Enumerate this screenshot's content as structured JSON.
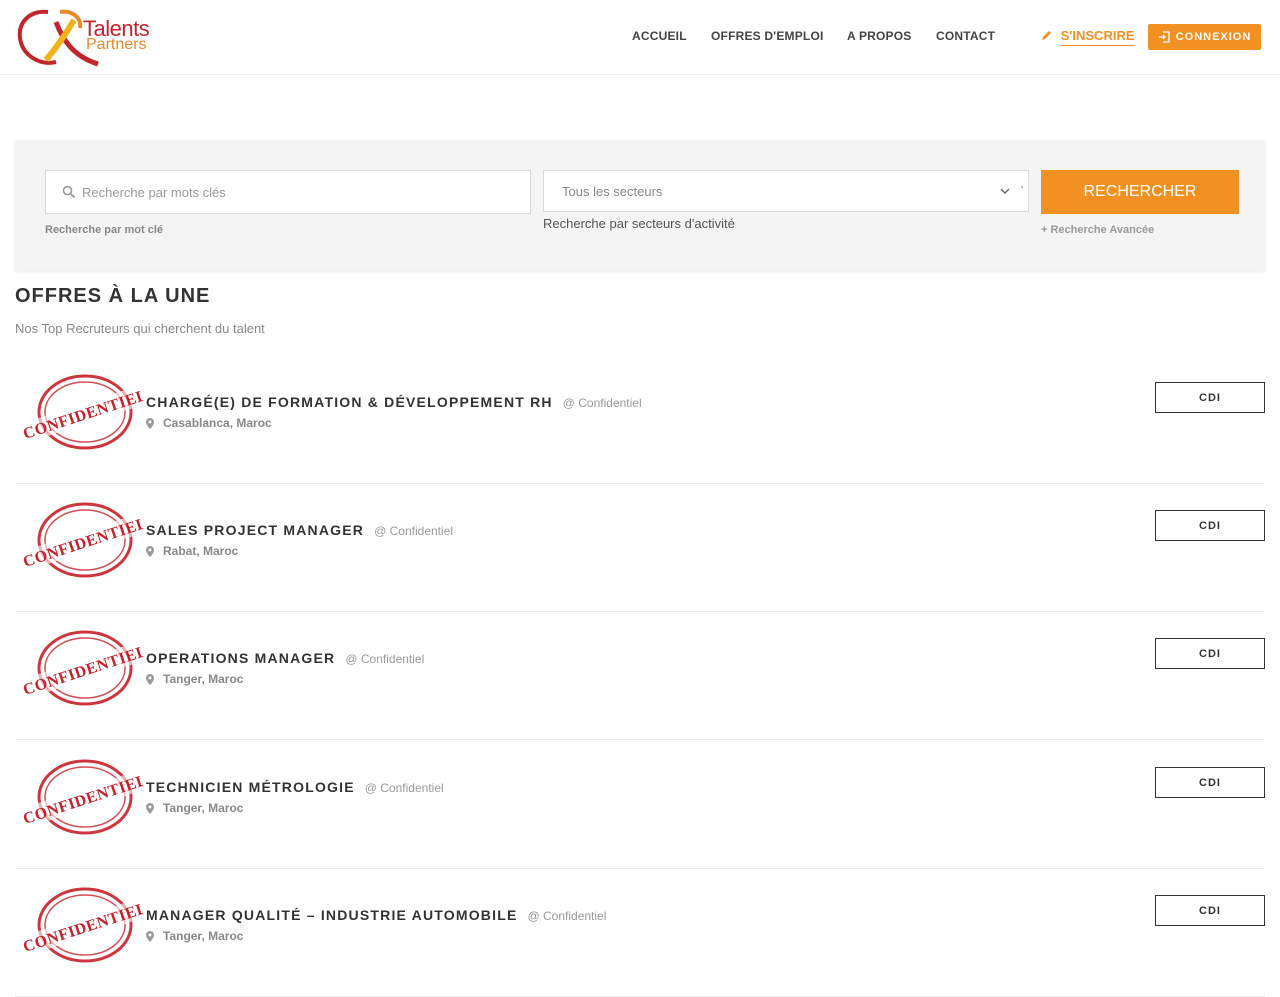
{
  "brand": {
    "line1": "Talents",
    "line2": "Partners"
  },
  "nav": {
    "items": [
      {
        "label": "ACCUEIL"
      },
      {
        "label": "OFFRES D'EMPLOI"
      },
      {
        "label": "A PROPOS"
      },
      {
        "label": "CONTACT"
      }
    ],
    "signup_label": "S'INSCRIRE",
    "login_label": "CONNEXION"
  },
  "search": {
    "keyword_placeholder": "Recherche par mots clés",
    "keyword_hint": "Recherche par mot clé",
    "sector_value": "Tous les secteurs",
    "sector_hint": "Recherche par secteurs d'activité",
    "button_label": "Rechercher",
    "advanced_label": "+ Recherche Avancée"
  },
  "section": {
    "title": "OFFRES À LA UNE",
    "subtitle": "Nos Top Recruteurs qui cherchent du talent"
  },
  "stamp_text": "CONFIDENTIEL",
  "jobs": [
    {
      "title": "CHARGÉ(E) DE FORMATION & DÉVELOPPEMENT RH",
      "company": "@ Confidentiel",
      "location": "Casablanca, Maroc",
      "type": "CDI"
    },
    {
      "title": "SALES PROJECT MANAGER",
      "company": "@ Confidentiel",
      "location": "Rabat, Maroc",
      "type": "CDI"
    },
    {
      "title": "OPERATIONS MANAGER",
      "company": "@ Confidentiel",
      "location": "Tanger, Maroc",
      "type": "CDI"
    },
    {
      "title": "TECHNICIEN MÉTROLOGIE",
      "company": "@ Confidentiel",
      "location": "Tanger, Maroc",
      "type": "CDI"
    },
    {
      "title": "MANAGER QUALITÉ – INDUSTRIE AUTOMOBILE",
      "company": "@ Confidentiel",
      "location": "Tanger, Maroc",
      "type": "CDI"
    }
  ],
  "colors": {
    "accent": "#f29122",
    "brand_red": "#c0262c",
    "stamp_red": "#c8202a"
  }
}
